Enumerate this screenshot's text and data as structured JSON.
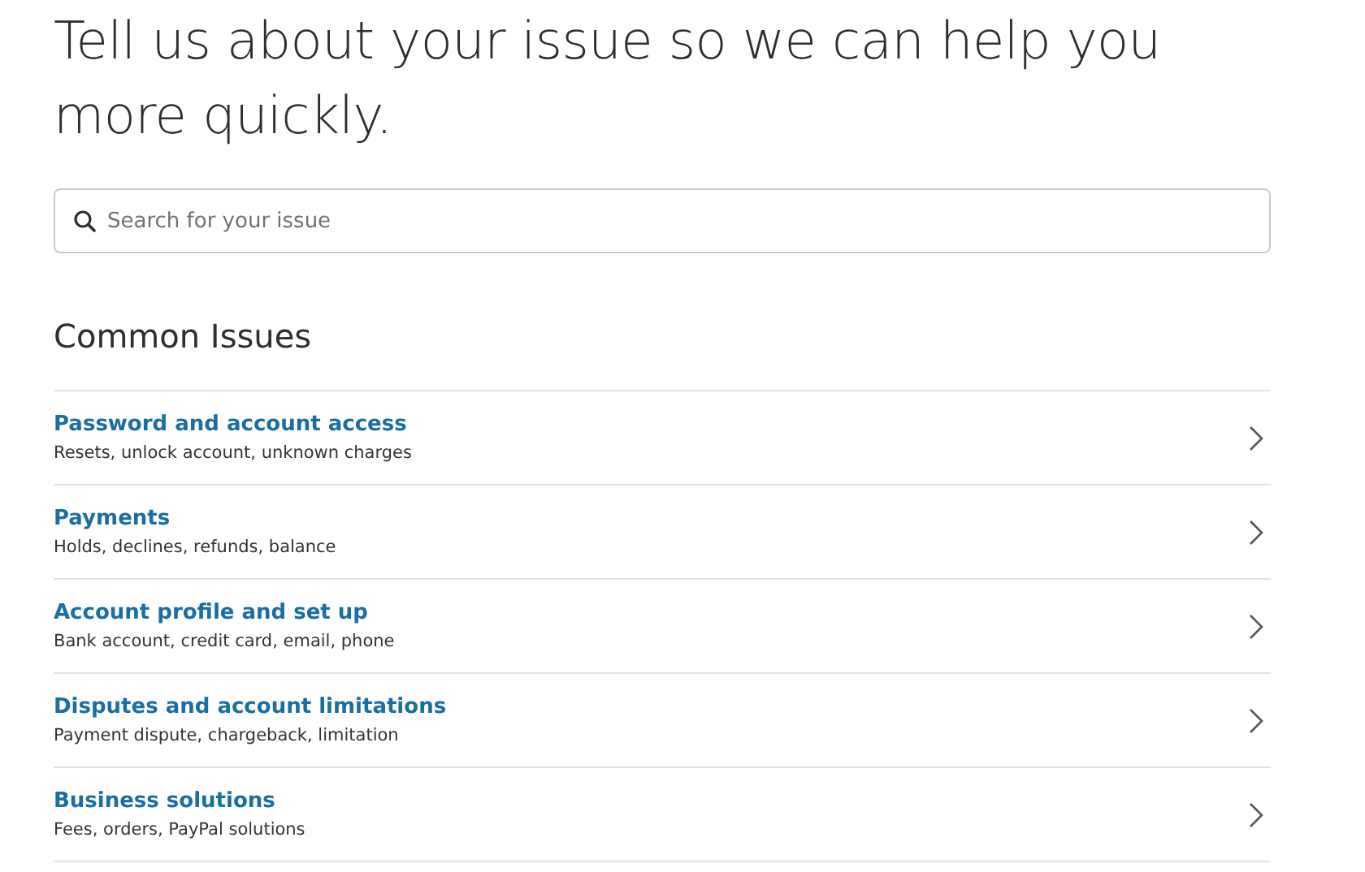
{
  "heading": "Tell us about your issue so we can help you more quickly.",
  "search": {
    "placeholder": "Search for your issue"
  },
  "section_title": "Common Issues",
  "issues": [
    {
      "title": "Password and account access",
      "description": "Resets, unlock account, unknown charges"
    },
    {
      "title": "Payments",
      "description": "Holds, declines, refunds, balance"
    },
    {
      "title": "Account profile and set up",
      "description": "Bank account, credit card, email, phone"
    },
    {
      "title": "Disputes and account limitations",
      "description": "Payment dispute, chargeback, limitation"
    },
    {
      "title": "Business solutions",
      "description": "Fees, orders, PayPal solutions"
    }
  ]
}
